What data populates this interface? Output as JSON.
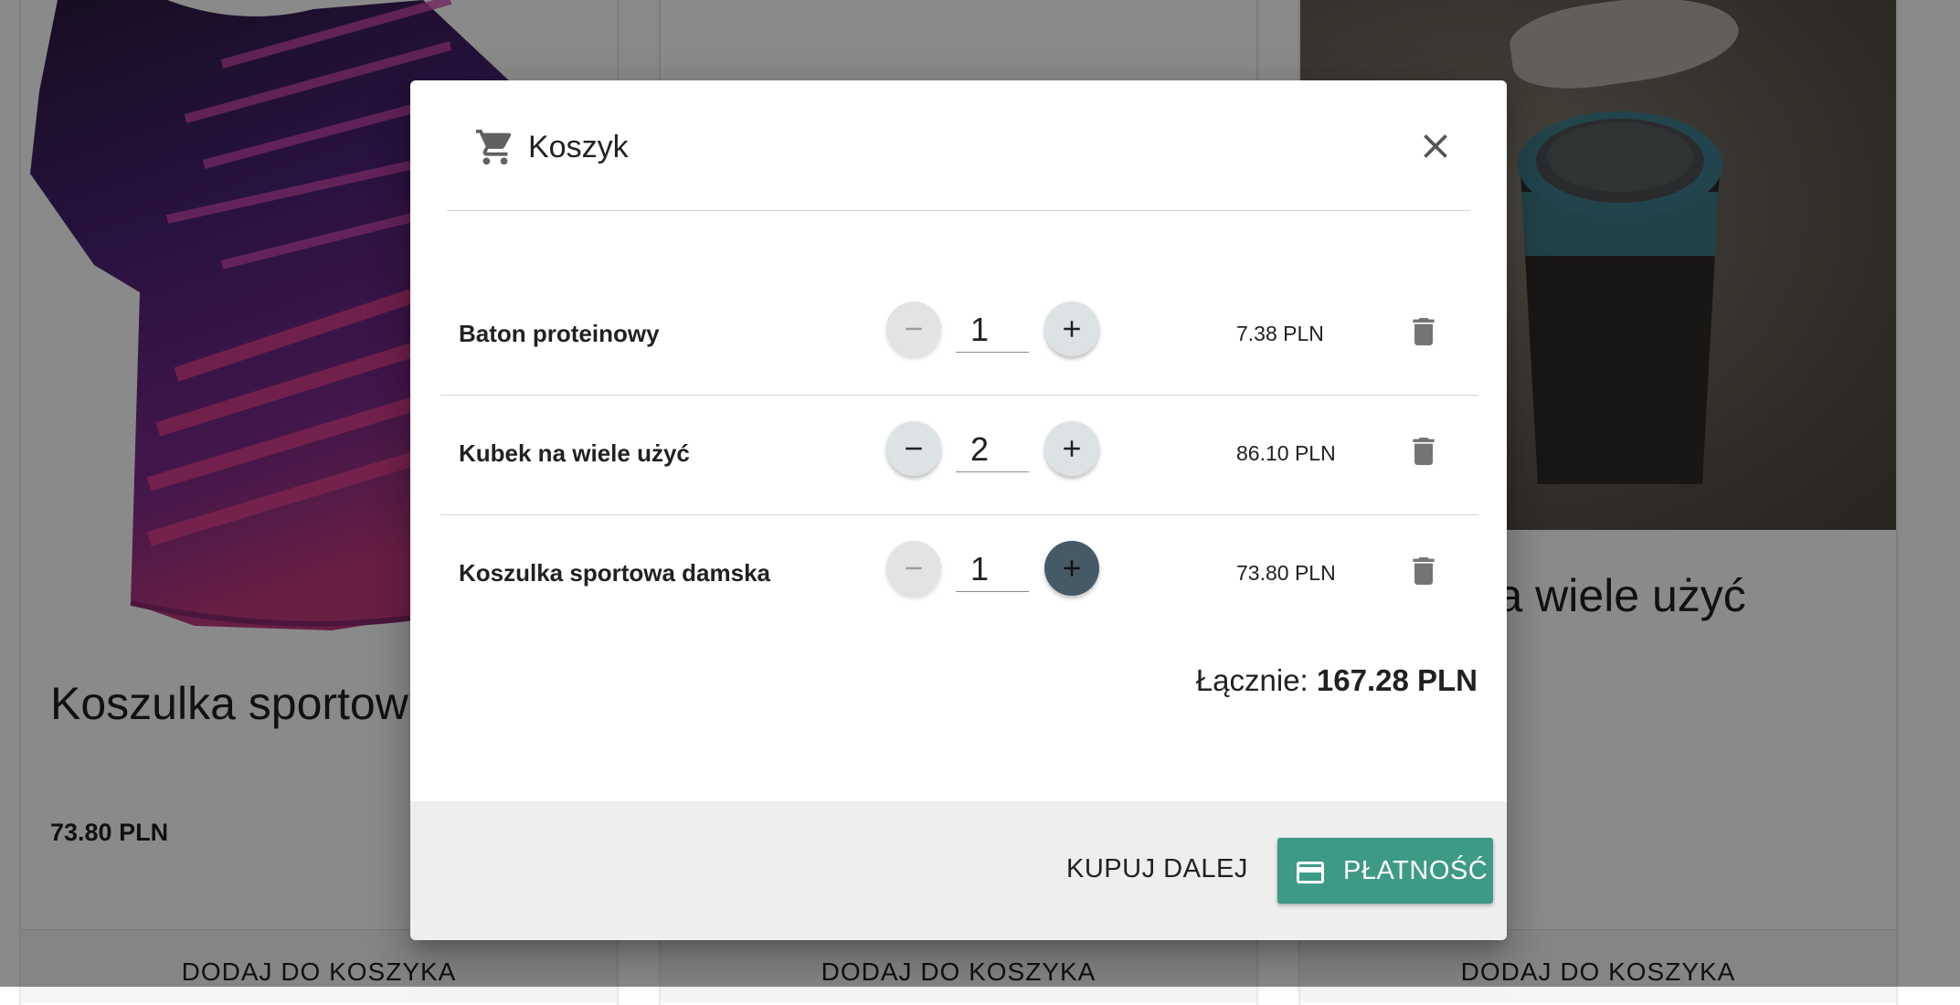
{
  "background": {
    "cards": [
      {
        "title": "Koszulka sportowa damska",
        "price": "73.80 PLN",
        "button_label": "DODAJ DO KOSZYKA"
      },
      {
        "title": "",
        "price": "",
        "button_label": "DODAJ DO KOSZYKA"
      },
      {
        "title": "Kubek na wiele użyć",
        "price": "",
        "button_label": "DODAJ DO KOSZYKA"
      }
    ]
  },
  "dialog": {
    "title": "Koszyk",
    "title_icon": "cart-icon",
    "close_icon": "close-icon",
    "items": [
      {
        "name": "Baton proteinowy",
        "quantity": "1",
        "price": "7.38 PLN",
        "minus_disabled": true
      },
      {
        "name": "Kubek na wiele użyć",
        "quantity": "2",
        "price": "86.10 PLN",
        "minus_disabled": false
      },
      {
        "name": "Koszulka sportowa damska",
        "quantity": "1",
        "price": "73.80 PLN",
        "minus_disabled": true
      }
    ],
    "total_label": "Łącznie:",
    "total_value": "167.28 PLN",
    "continue_label": "KUPUJ DALEJ",
    "payment_label": "PŁATNOŚĆ",
    "payment_icon": "credit-card-icon"
  },
  "colors": {
    "accent": "#3d9a86",
    "secondary": "#455a64",
    "overlay": "rgba(0,0,0,0.46)"
  }
}
